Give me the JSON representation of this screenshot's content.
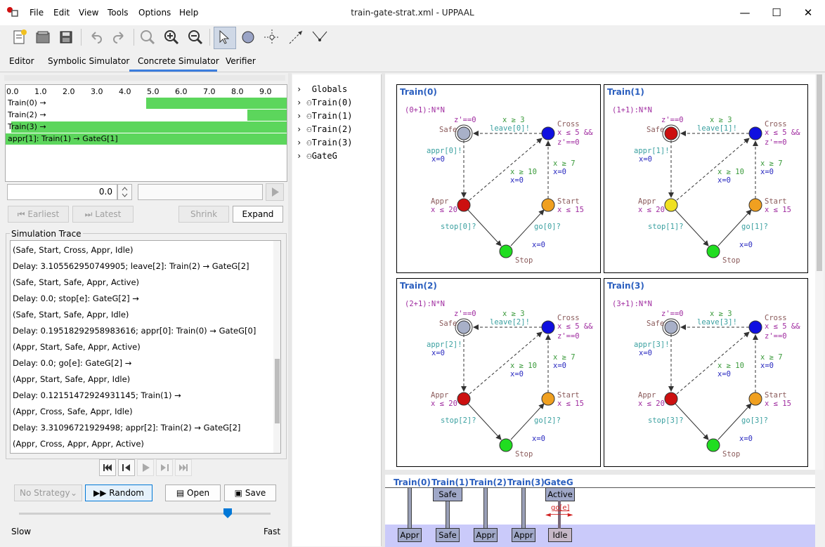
{
  "window": {
    "title": "train-gate-strat.xml - UPPAAL",
    "menu": [
      "File",
      "Edit",
      "View",
      "Tools",
      "Options",
      "Help"
    ],
    "controls": {
      "minimize": "—",
      "maximize": "☐",
      "close": "✕"
    }
  },
  "toolbar": {
    "icons": [
      "new-document-icon",
      "open-folder-icon",
      "save-icon",
      "undo-icon",
      "redo-icon",
      "zoom-fit-icon",
      "zoom-in-icon",
      "zoom-out-icon",
      "select-pointer-icon",
      "location-icon",
      "branch-icon",
      "edge-icon",
      "nail-icon"
    ]
  },
  "tabs": [
    {
      "label": "Editor"
    },
    {
      "label": "Symbolic Simulator"
    },
    {
      "label": "Concrete Simulator",
      "active": true
    },
    {
      "label": "Verifier"
    }
  ],
  "timeline": {
    "ruler": [
      "0.0",
      "1.0",
      "2.0",
      "3.0",
      "4.0",
      "5.0",
      "6.0",
      "7.0",
      "8.0",
      "9.0"
    ],
    "rows": [
      {
        "label": "Train(0) →",
        "green_from": 5.0
      },
      {
        "label": "Train(2) →",
        "green_from": 8.6
      },
      {
        "label": "Train(3) →",
        "green_from": 0.2
      },
      {
        "label": "appr[1]: Train(1) → GateG[1]",
        "green_from": 0.0
      }
    ]
  },
  "time_input": {
    "value": "0.0"
  },
  "nav_buttons": {
    "earliest": "Earliest",
    "latest": "Latest",
    "shrink": "Shrink",
    "expand": "Expand"
  },
  "trace": {
    "title": "Simulation Trace",
    "lines": [
      "(Safe, Start, Cross, Appr, Idle)",
      "Delay: 3.105562950749905; leave[2]: Train(2) → GateG[2]",
      "(Safe, Start, Safe, Appr, Active)",
      "Delay: 0.0; stop[e]: GateG[2] →",
      "(Safe, Start, Safe, Appr, Idle)",
      "Delay: 0.19518292958983616; appr[0]: Train(0) → GateG[0]",
      "(Appr, Start, Safe, Appr, Active)",
      "Delay: 0.0; go[e]: GateG[2] →",
      "(Appr, Start, Safe, Appr, Idle)",
      "Delay: 0.12151472924931145; Train(1) →",
      "(Appr, Cross, Safe, Appr, Idle)",
      "Delay: 3.31096721929498; appr[2]: Train(2) → GateG[2]",
      "(Appr, Cross, Appr, Appr, Active)"
    ]
  },
  "controls": {
    "strategy": "No Strategy",
    "random": "Random",
    "open": "Open",
    "save": "Save",
    "slow": "Slow",
    "fast": "Fast",
    "speed": 0.83
  },
  "tree": [
    "Globals",
    "Train(0)",
    "Train(1)",
    "Train(2)",
    "Train(3)",
    "GateG"
  ],
  "processes": [
    {
      "title": "Train(0)",
      "param": "(0+1):N*N",
      "appr_guard": "appr[0]!",
      "leave": "leave[0]!",
      "stop": "stop[0]?",
      "go": "go[0]?",
      "appr_color": "#cc1010",
      "safe_color": "#a8b0c8",
      "cross_color": "#1010e0",
      "start_color": "#f0a020",
      "stop_color": "#20dd20"
    },
    {
      "title": "Train(1)",
      "param": "(1+1):N*N",
      "appr_guard": "appr[1]!",
      "leave": "leave[1]!",
      "stop": "stop[1]?",
      "go": "go[1]?",
      "appr_color": "#f0e020",
      "safe_color": "#cc1010",
      "cross_color": "#1010e0",
      "start_color": "#f0a020",
      "stop_color": "#20dd20"
    },
    {
      "title": "Train(2)",
      "param": "(2+1):N*N",
      "appr_guard": "appr[2]!",
      "leave": "leave[2]!",
      "stop": "stop[2]?",
      "go": "go[2]?",
      "appr_color": "#cc1010",
      "safe_color": "#a8b0c8",
      "cross_color": "#1010e0",
      "start_color": "#f0a020",
      "stop_color": "#20dd20"
    },
    {
      "title": "Train(3)",
      "param": "(3+1):N*N",
      "appr_guard": "appr[3]!",
      "leave": "leave[3]!",
      "stop": "stop[3]?",
      "go": "go[3]?",
      "appr_color": "#cc1010",
      "safe_color": "#a8b0c8",
      "cross_color": "#1010e0",
      "start_color": "#f0a020",
      "stop_color": "#20dd20"
    }
  ],
  "process_text": {
    "safe": "Safe",
    "cross": "Cross",
    "appr": "Appr",
    "start": "Start",
    "stopl": "Stop",
    "z0": "z'==0",
    "xge3": "x ≥ 3",
    "xle5": "x ≤ 5  &&",
    "zprime": "z'==0",
    "x0": "x=0",
    "xge10": "x ≥ 10",
    "xge7": "x ≥ 7",
    "xle20": "x ≤ 20",
    "xle15": "x ≤  15"
  },
  "msc": {
    "names": [
      "Train(0)",
      "Train(1)",
      "Train(2)",
      "Train(3)",
      "GateG"
    ],
    "top_boxes": [
      {
        "proc": 1,
        "label": "Safe"
      },
      {
        "proc": 4,
        "label": "Active"
      }
    ],
    "edge_label": "go[e]",
    "bottom_boxes": [
      "Appr",
      "Safe",
      "Appr",
      "Appr",
      "Idle"
    ]
  }
}
